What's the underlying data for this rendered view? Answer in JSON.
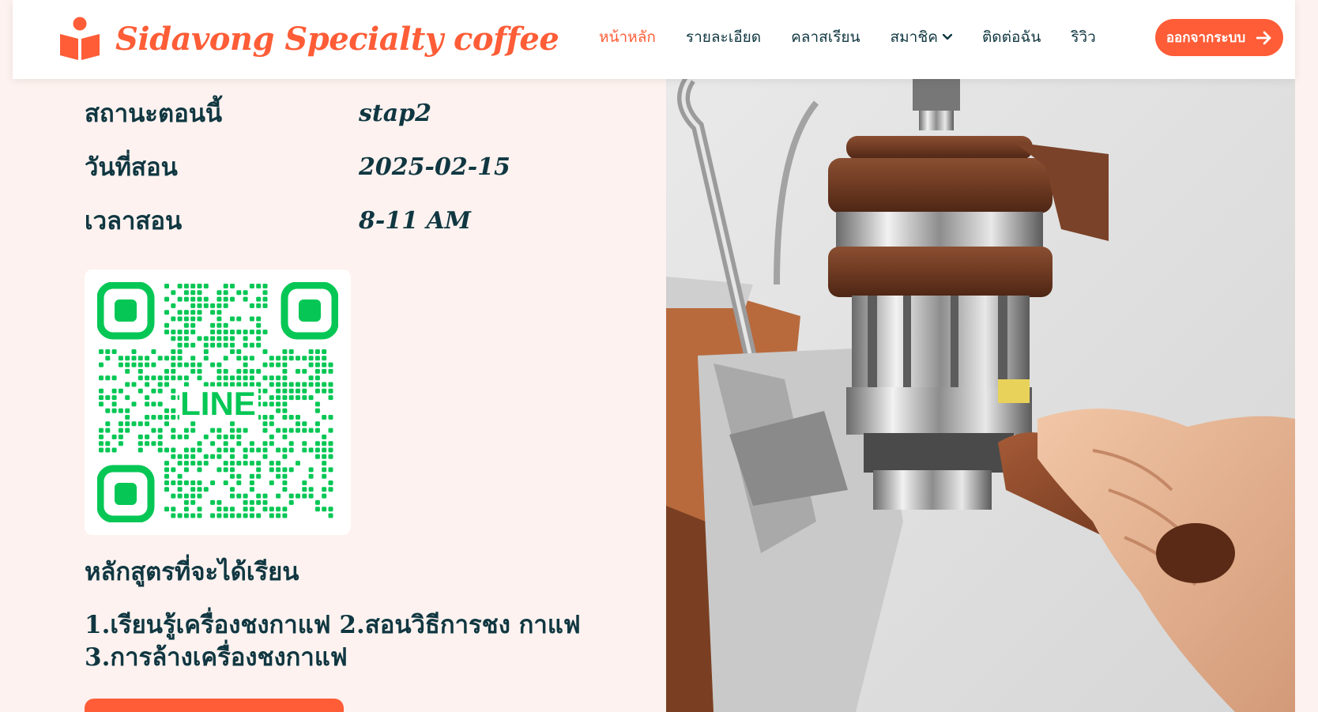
{
  "brand": {
    "name": "Sidavong Specialty coffee",
    "icon": "open-book-reader-icon",
    "color": "#fe5d37"
  },
  "nav": {
    "items": [
      {
        "label": "หน้าหลัก",
        "active": true
      },
      {
        "label": "รายละเอียด",
        "active": false
      },
      {
        "label": "คลาสเรียน",
        "active": false
      },
      {
        "label": "สมาชิค",
        "active": false,
        "dropdown": true
      },
      {
        "label": "ติดต่อฉัน",
        "active": false
      },
      {
        "label": "ริวิว",
        "active": false
      }
    ],
    "logout_label": "ออกจากระบบ",
    "logout_icon": "arrow-right-icon"
  },
  "info": {
    "status_label": "สถานะตอนนี้",
    "status_value": "stap2",
    "date_label": "วันที่สอน",
    "date_value": "2025-02-15",
    "time_label": "เวลาสอน",
    "time_value": "8-11 AM"
  },
  "qr": {
    "center_text": "LINE",
    "color": "#06c755"
  },
  "course": {
    "title": "หลักสูตรที่จะได้เรียน",
    "body": "1.เรียนรู้เครื่องชงกาแฟ 2.สอนวิธีการชง กาแฟ 3.การล้างเครื่องชงกาแฟ"
  },
  "colors": {
    "accent": "#fe5d37",
    "text": "#103741",
    "background": "#fdf2ef"
  }
}
